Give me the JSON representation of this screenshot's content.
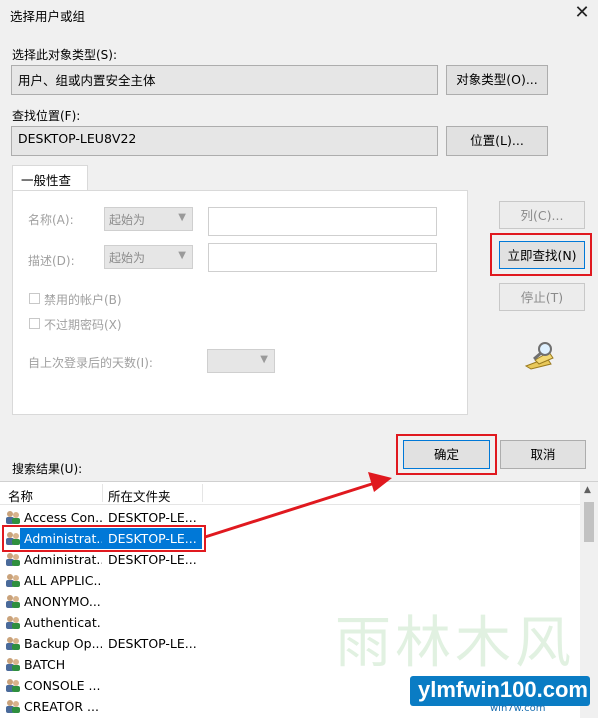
{
  "window": {
    "title": "选择用户或组",
    "close_glyph": "✕"
  },
  "object_type": {
    "label": "选择此对象类型(S):",
    "value": "用户、组或内置安全主体",
    "button": "对象类型(O)..."
  },
  "location": {
    "label": "查找位置(F):",
    "value": "DESKTOP-LEU8V22",
    "button": "位置(L)..."
  },
  "tab": {
    "label": "一般性查询"
  },
  "query": {
    "name_label": "名称(A):",
    "name_mode": "起始为",
    "desc_label": "描述(D):",
    "desc_mode": "起始为",
    "disabled_accounts": "禁用的帐户(B)",
    "no_expire_pw": "不过期密码(X)",
    "days_label": "自上次登录后的天数(I):"
  },
  "side_buttons": {
    "columns": "列(C)...",
    "find_now": "立即查找(N)",
    "stop": "停止(T)"
  },
  "ok_button": "确定",
  "cancel_button": "取消",
  "results_label": "搜索结果(U):",
  "table": {
    "columns": [
      "名称",
      "所在文件夹"
    ],
    "rows": [
      {
        "name": "Access Con...",
        "folder": "DESKTOP-LE..."
      },
      {
        "name": "Administrat...",
        "folder": "DESKTOP-LE...",
        "selected": true
      },
      {
        "name": "Administrat...",
        "folder": "DESKTOP-LE..."
      },
      {
        "name": "ALL APPLIC...",
        "folder": ""
      },
      {
        "name": "ANONYMO...",
        "folder": ""
      },
      {
        "name": "Authenticat...",
        "folder": ""
      },
      {
        "name": "Backup Op...",
        "folder": "DESKTOP-LE..."
      },
      {
        "name": "BATCH",
        "folder": ""
      },
      {
        "name": "CONSOLE ...",
        "folder": ""
      },
      {
        "name": "CREATOR ...",
        "folder": ""
      }
    ]
  },
  "watermark": {
    "cn": "雨林木风",
    "site": "ylmfwin100.com",
    "sub": "win7w.com"
  },
  "colors": {
    "highlight": "#e0191f",
    "selection": "#0078d7",
    "arrow": "#e0191f"
  }
}
